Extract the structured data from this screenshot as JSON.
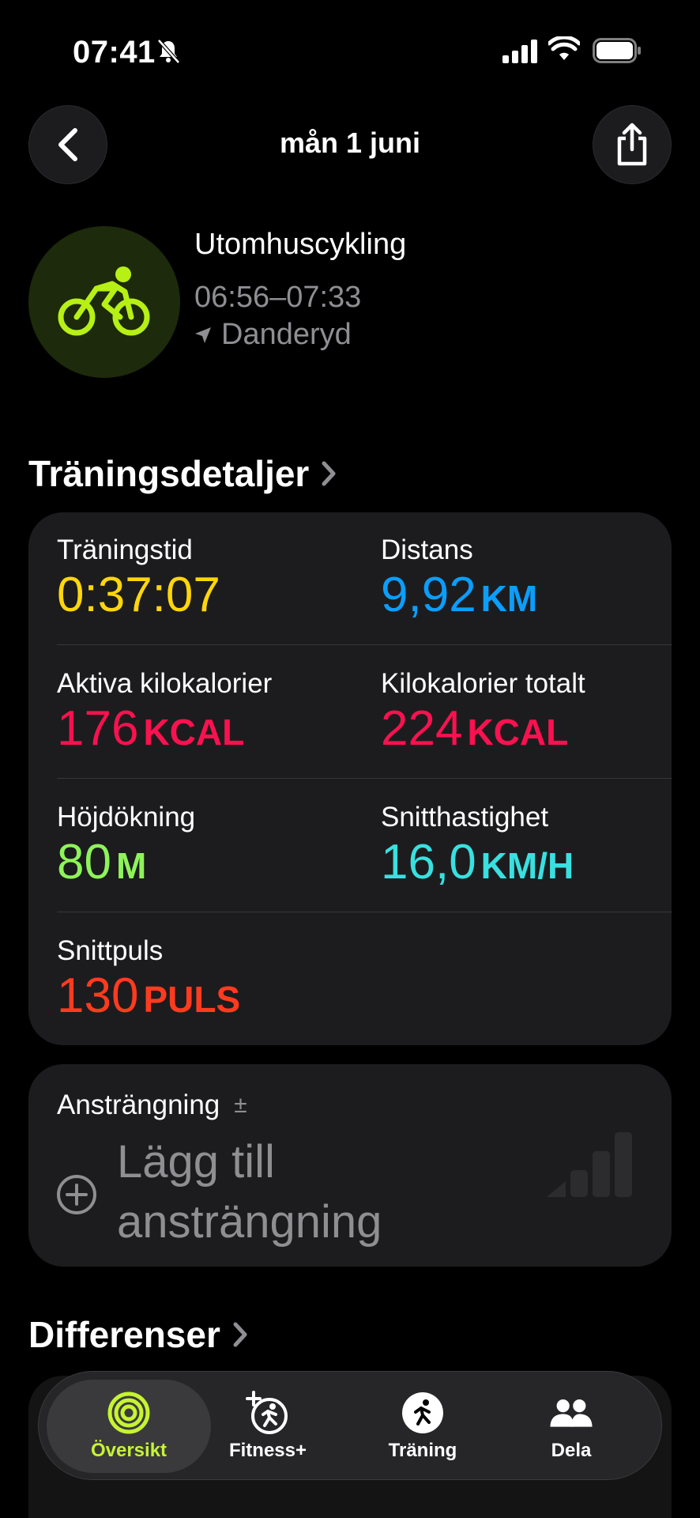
{
  "status_bar": {
    "time": "07:41"
  },
  "nav": {
    "title": "mån 1 juni"
  },
  "workout": {
    "name": "Utomhuscykling",
    "time_range": "06:56–07:33",
    "location": "Danderyd",
    "accent_color": "#b6f014"
  },
  "details": {
    "section_title": "Träningsdetaljer",
    "metrics": [
      {
        "label": "Träningstid",
        "value": "0:37:07",
        "unit": "",
        "color": "#ffd60a"
      },
      {
        "label": "Distans",
        "value": "9,92",
        "unit": "KM",
        "color": "#0a9eff"
      },
      {
        "label": "Aktiva kilokalorier",
        "value": "176",
        "unit": "KCAL",
        "color": "#fa114f"
      },
      {
        "label": "Kilokalorier totalt",
        "value": "224",
        "unit": "KCAL",
        "color": "#fa114f"
      },
      {
        "label": "Höjdökning",
        "value": "80",
        "unit": "M",
        "color": "#8ef35b"
      },
      {
        "label": "Snitthastighet",
        "value": "16,0",
        "unit": "KM/H",
        "color": "#39e0e0"
      },
      {
        "label": "Snittpuls",
        "value": "130",
        "unit": "PULS",
        "color": "#ff3b1f"
      }
    ]
  },
  "effort": {
    "label": "Ansträngning",
    "pm_symbol": "±",
    "add_label": "Lägg till ansträngning"
  },
  "splits": {
    "section_title": "Differenser"
  },
  "tabs": [
    {
      "label": "Översikt",
      "active": true
    },
    {
      "label": "Fitness+",
      "active": false
    },
    {
      "label": "Träning",
      "active": false
    },
    {
      "label": "Dela",
      "active": false
    }
  ]
}
